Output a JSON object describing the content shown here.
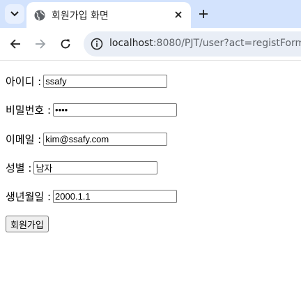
{
  "browser": {
    "tab_title": "회원가입 화면",
    "url_host": "localhost",
    "url_rest": ":8080/PJT/user?act=registForm"
  },
  "form": {
    "fields": [
      {
        "label": "아이디 :",
        "value": "ssafy"
      },
      {
        "label": "비밀번호 :",
        "value": "••••"
      },
      {
        "label": "이메일 :",
        "value": "kim@ssafy.com"
      },
      {
        "label": "성별 :",
        "value": "남자"
      },
      {
        "label": "생년월일 :",
        "value": "2000.1.1"
      }
    ],
    "submit_label": "회원가입"
  }
}
